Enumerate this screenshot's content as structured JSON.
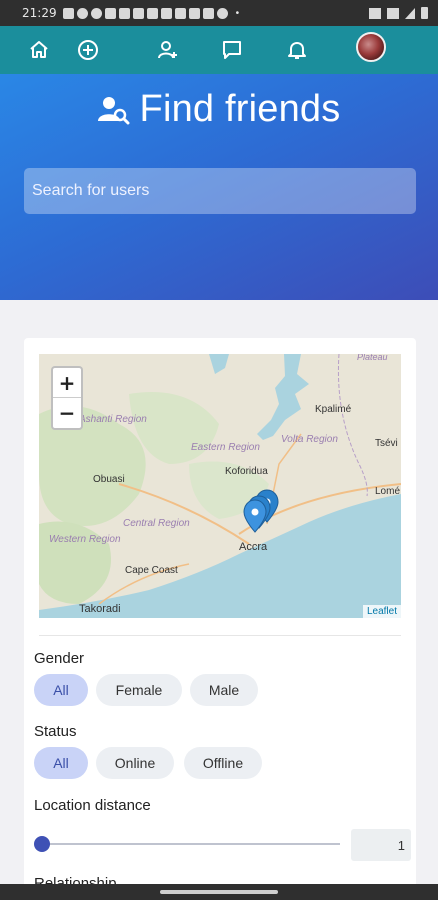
{
  "status_bar": {
    "time": "21:29",
    "dot": "•"
  },
  "nav": {
    "icons": [
      "home-icon",
      "add-circle-icon",
      "add-user-icon",
      "chat-icon",
      "bell-icon"
    ]
  },
  "hero": {
    "title": "Find friends",
    "search_placeholder": "Search for users"
  },
  "map": {
    "zoom_in": "+",
    "zoom_out": "−",
    "attribution": "Leaflet",
    "places": [
      "Plateau",
      "Ashanti Region",
      "Kpalimé",
      "Eastern Region",
      "Volta Region",
      "Tsévi",
      "Koforidua",
      "Obuasi",
      "Lomé",
      "Central Region",
      "Western Region",
      "Accra",
      "Cape Coast",
      "Takoradi"
    ]
  },
  "filters": {
    "gender": {
      "label": "Gender",
      "options": [
        "All",
        "Female",
        "Male"
      ],
      "selected": "All"
    },
    "status": {
      "label": "Status",
      "options": [
        "All",
        "Online",
        "Offline"
      ],
      "selected": "All"
    },
    "location": {
      "label": "Location distance",
      "value": "1"
    },
    "relationship": {
      "label": "Relationship"
    }
  },
  "colors": {
    "nav": "#1b8e9c",
    "accent": "#3f51b5",
    "chip_active": "#c9d3f7"
  }
}
